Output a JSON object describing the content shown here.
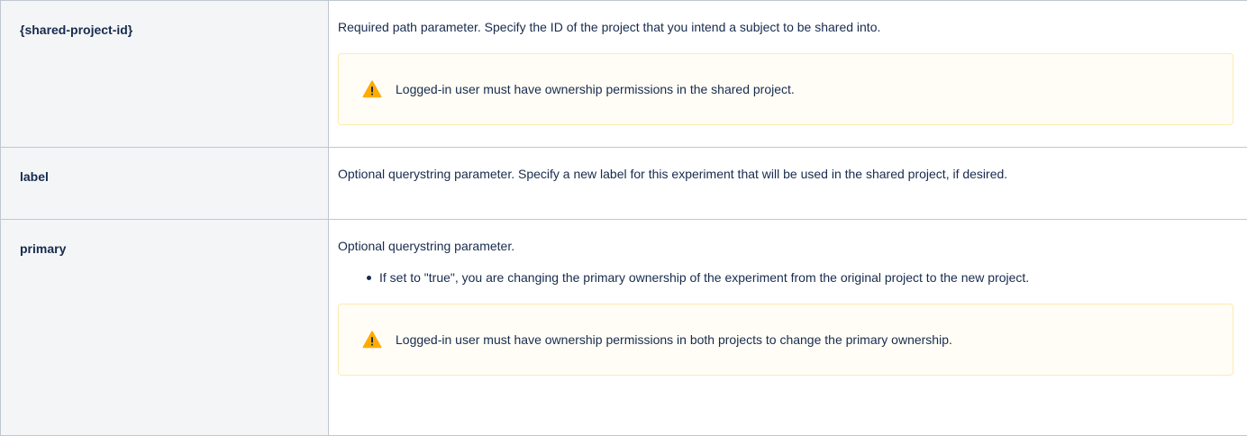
{
  "rows": [
    {
      "name": "{shared-project-id}",
      "description": "Required path parameter. Specify the ID of the project that you intend a subject to be shared into.",
      "warning": "Logged-in user must have ownership permissions in the shared project."
    },
    {
      "name": "label",
      "description": "Optional querystring parameter. Specify a new label for this experiment that will be used in the shared project, if desired."
    },
    {
      "name": "primary",
      "description": "Optional querystring parameter.",
      "bullets": [
        "If set to \"true\", you are changing the primary ownership of the experiment from the original project to the new project."
      ],
      "warning": "Logged-in user must have ownership permissions in both projects to change the primary ownership."
    }
  ],
  "icons": {
    "warning": "warning-icon"
  },
  "colors": {
    "warning_fill": "#ffab00",
    "warning_panel_bg": "#fffdf6",
    "warning_panel_border": "#ffeaae",
    "header_cell_bg": "#f4f5f7",
    "border": "#c1c7d0",
    "text": "#172b4d"
  }
}
